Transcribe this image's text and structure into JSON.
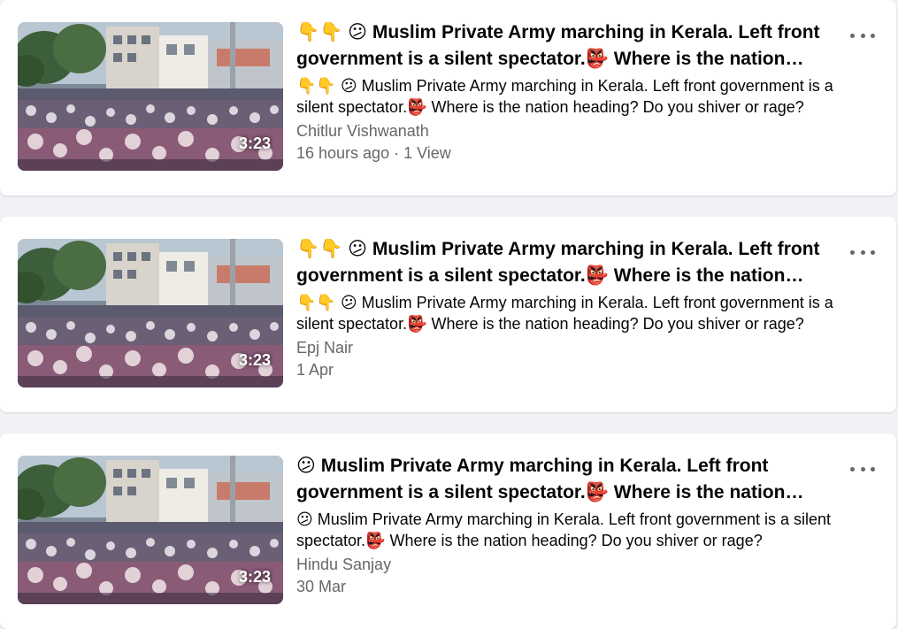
{
  "colors": {
    "background": "#f0f2f5",
    "card": "#ffffff",
    "primary_text": "#050505",
    "secondary_text": "#65676b"
  },
  "results": [
    {
      "title": "👇👇 😕 Muslim Private Army marching in Kerala. Left front government is a silent spectator.👺 Where is the nation heading? Do you shiver or rage?",
      "description": "👇👇 😕 Muslim Private Army marching in Kerala. Left front government is a silent spectator.👺 Where is the nation heading? Do you shiver or rage?",
      "duration": "3:23",
      "author": "Chitlur Vishwanath",
      "meta": "16 hours ago · 1 View",
      "more_icon": "more-horizontal-icon"
    },
    {
      "title": "👇👇 😕 Muslim Private Army marching in Kerala. Left front government is a silent spectator.👺 Where is the nation heading? Do you shiver or rage?",
      "description": "👇👇 😕 Muslim Private Army marching in Kerala. Left front government is a silent spectator.👺 Where is the nation heading? Do you shiver or rage?",
      "duration": "3:23",
      "author": "Epj Nair",
      "meta": "1 Apr",
      "more_icon": "more-horizontal-icon"
    },
    {
      "title": "😕 Muslim Private Army marching in Kerala. Left front government is a silent spectator.👺 Where is the nation heading? Do you shiver or rage?",
      "description": "😕 Muslim Private Army marching in Kerala. Left front government is a silent spectator.👺 Where is the nation heading? Do you shiver or rage?",
      "duration": "3:23",
      "author": "Hindu Sanjay",
      "meta": "30 Mar",
      "more_icon": "more-horizontal-icon"
    }
  ]
}
